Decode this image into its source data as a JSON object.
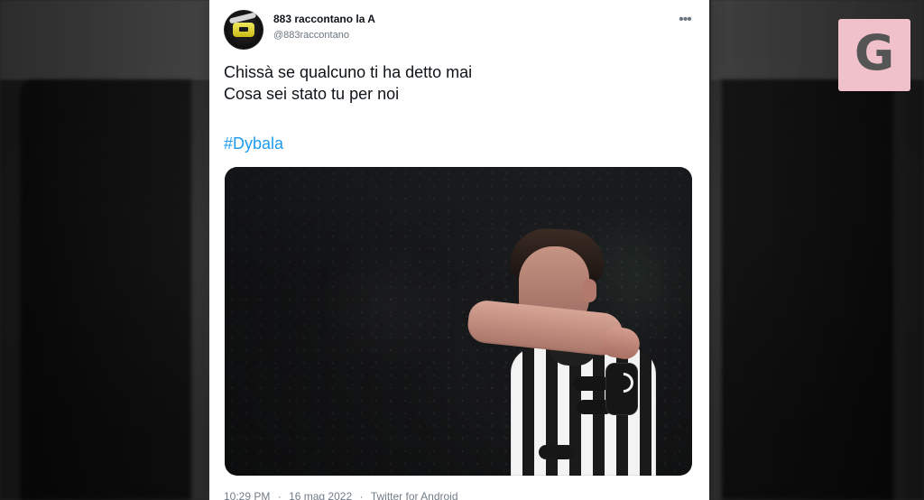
{
  "watermark": {
    "letter": "G"
  },
  "tweet": {
    "account": {
      "name": "883 raccontano la A",
      "handle": "@883raccontano"
    },
    "text_lines": [
      "Chissà se qualcuno ti ha detto mai",
      "Cosa sei stato tu per noi"
    ],
    "hashtag": "#Dybala",
    "footer": {
      "time": "10:29 PM",
      "separator_1": "·",
      "date": "16 mag 2022",
      "separator_2": "·",
      "source": "Twitter for Android"
    }
  },
  "icons": {
    "more_options": "more-options-icon",
    "avatar": "avatar-icon"
  },
  "colors": {
    "tweet_background": "#ffffff",
    "hashtag": "#1d9bf0",
    "text": "#0f1419",
    "secondary_text": "#6b7680",
    "watermark_background": "#f0c1cb"
  }
}
